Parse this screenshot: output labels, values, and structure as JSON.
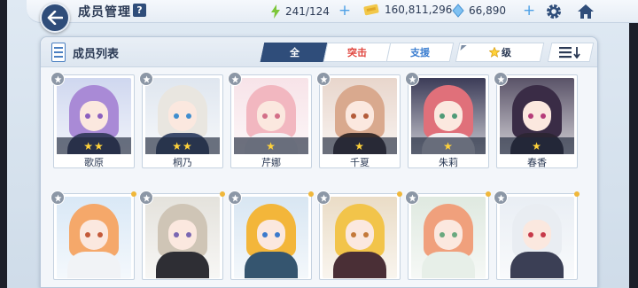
{
  "header": {
    "title": "成员管理",
    "help_label": "?",
    "energy": "241/124",
    "credits": "160,811,296",
    "gems": "66,890",
    "plus": "+"
  },
  "panel": {
    "title": "成员列表",
    "tabs": [
      {
        "label": "全"
      },
      {
        "label": "突击"
      },
      {
        "label": "支援"
      }
    ],
    "sort_label": "级",
    "order_symbol": "☰↓"
  },
  "cards": [
    {
      "name": "歌原",
      "stars": "★★",
      "hair": "#a98ad6",
      "body": "#3a3f62",
      "eye": "#8b5fbf",
      "bg": "#cfd7ef"
    },
    {
      "name": "桐乃",
      "stars": "★★",
      "hair": "#e9e6e0",
      "body": "#3b4a6a",
      "eye": "#3f8ecf",
      "bg": "#dfe6ef"
    },
    {
      "name": "芹娜",
      "stars": "★",
      "hair": "#f2b7c0",
      "body": "#f3f1f4",
      "eye": "#d36f88",
      "bg": "#f7e3e8"
    },
    {
      "name": "千夏",
      "stars": "★",
      "hair": "#d9a98e",
      "body": "#3a2d2b",
      "eye": "#b45c3a",
      "bg": "#e8d6cc"
    },
    {
      "name": "朱莉",
      "stars": "★",
      "hair": "#e0707a",
      "body": "#f1eef0",
      "eye": "#4f9a77",
      "bg": "#3c3c58"
    },
    {
      "name": "春香",
      "stars": "★",
      "hair": "#3a2c46",
      "body": "#2c2533",
      "eye": "#b63c7a",
      "bg": "#5a5368"
    },
    {
      "name": "",
      "stars": "",
      "hair": "#f5a86a",
      "body": "#f1f3f6",
      "eye": "#c45a3a",
      "bg": "#d9e8f6"
    },
    {
      "name": "",
      "stars": "",
      "hair": "#cfc5b6",
      "body": "#2e2e34",
      "eye": "#7a67b2",
      "bg": "#e4e2dc"
    },
    {
      "name": "",
      "stars": "",
      "hair": "#f3b63a",
      "body": "#35556f",
      "eye": "#3b7acc",
      "bg": "#d8e6f2"
    },
    {
      "name": "",
      "stars": "",
      "hair": "#f2c44a",
      "body": "#4a2f36",
      "eye": "#c4793a",
      "bg": "#eadcc6"
    },
    {
      "name": "",
      "stars": "",
      "hair": "#f0a07c",
      "body": "#e7efe8",
      "eye": "#6aa87f",
      "bg": "#dfe9e0"
    },
    {
      "name": "",
      "stars": "",
      "hair": "#e9edf2",
      "body": "#3b3f55",
      "eye": "#c73a4a",
      "bg": "#e9eef4"
    }
  ]
}
